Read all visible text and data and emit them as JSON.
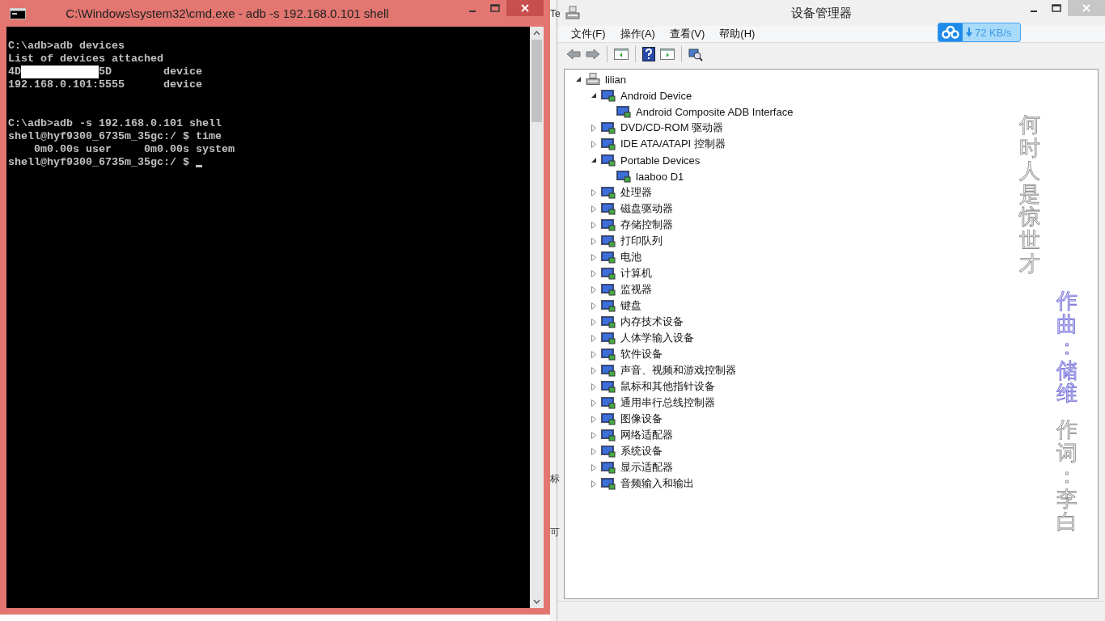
{
  "console_window": {
    "title": "C:\\Windows\\system32\\cmd.exe - adb  -s 192.168.0.101 shell",
    "blocks": [
      [
        {
          "kind": "text",
          "text": "C:\\adb>adb devices"
        },
        {
          "kind": "text",
          "text": "List of devices attached"
        },
        {
          "kind": "redacted_device",
          "id_start": "4D",
          "id_end": "5D",
          "state": "device"
        },
        {
          "kind": "device",
          "id": "192.168.0.101:5555",
          "state": "device"
        }
      ],
      [
        {
          "kind": "text",
          "text": "C:\\adb>adb -s 192.168.0.101 shell"
        },
        {
          "kind": "text",
          "text": "shell@hyf9300_6735m_35gc:/ $ time"
        },
        {
          "kind": "text",
          "text": "    0m0.00s user     0m0.00s system"
        },
        {
          "kind": "prompt",
          "text": "shell@hyf9300_6735m_35gc:/ $ "
        }
      ]
    ]
  },
  "background_window": {
    "texts": [
      "Te",
      "标",
      "可"
    ]
  },
  "device_manager": {
    "title": "设备管理器",
    "menu": [
      "文件(F)",
      "操作(A)",
      "查看(V)",
      "帮助(H)"
    ],
    "speed_widget": {
      "speed": "72 KB/s"
    },
    "tree": [
      {
        "label": "lilian",
        "kind": "computer",
        "expanded": true,
        "children": [
          {
            "label": "Android Device",
            "expanded": true,
            "children": [
              {
                "label": "Android Composite ADB Interface"
              }
            ]
          },
          {
            "label": "DVD/CD-ROM 驱动器",
            "expanded": false
          },
          {
            "label": "IDE ATA/ATAPI 控制器",
            "expanded": false
          },
          {
            "label": "Portable Devices",
            "expanded": true,
            "children": [
              {
                "label": "laaboo D1"
              }
            ]
          },
          {
            "label": "处理器",
            "expanded": false
          },
          {
            "label": "磁盘驱动器",
            "expanded": false
          },
          {
            "label": "存储控制器",
            "expanded": false
          },
          {
            "label": "打印队列",
            "expanded": false
          },
          {
            "label": "电池",
            "expanded": false
          },
          {
            "label": "计算机",
            "expanded": false
          },
          {
            "label": "监视器",
            "expanded": false
          },
          {
            "label": "键盘",
            "expanded": false
          },
          {
            "label": "内存技术设备",
            "expanded": false
          },
          {
            "label": "人体学输入设备",
            "expanded": false
          },
          {
            "label": "软件设备",
            "expanded": false
          },
          {
            "label": "声音、视频和游戏控制器",
            "expanded": false
          },
          {
            "label": "鼠标和其他指针设备",
            "expanded": false
          },
          {
            "label": "通用串行总线控制器",
            "expanded": false
          },
          {
            "label": "图像设备",
            "expanded": false
          },
          {
            "label": "网络适配器",
            "expanded": false
          },
          {
            "label": "系统设备",
            "expanded": false
          },
          {
            "label": "显示适配器",
            "expanded": false
          },
          {
            "label": "音频输入和输出",
            "expanded": false
          }
        ]
      }
    ]
  },
  "lyrics": [
    {
      "text": "何时人是惊世才",
      "highlighted": false
    },
    {
      "text": "作曲：储维",
      "highlighted": true
    },
    {
      "text": "作词：李白",
      "highlighted": false
    }
  ]
}
